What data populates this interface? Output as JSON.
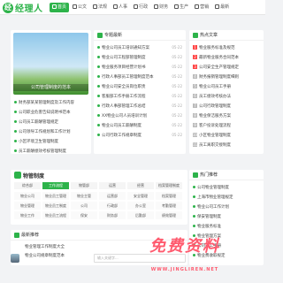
{
  "brand": {
    "logo_letter": "经",
    "name": "经理人"
  },
  "nav": [
    {
      "label": "首页",
      "icon": "home-icon",
      "active": true
    },
    {
      "label": "公文",
      "icon": "doc-icon"
    },
    {
      "label": "法规",
      "icon": "law-icon"
    },
    {
      "label": "人事",
      "icon": "person-icon"
    },
    {
      "label": "行政",
      "icon": "admin-icon"
    },
    {
      "label": "财务",
      "icon": "money-icon"
    },
    {
      "label": "生产",
      "icon": "factory-icon"
    },
    {
      "label": "营销",
      "icon": "market-icon"
    },
    {
      "label": "最新",
      "icon": "new-icon"
    }
  ],
  "hero": {
    "caption": "公司管理制度的范本"
  },
  "left_list": [
    "财务部某某管理制度及工作内容",
    "公司职业危害告知说明书范本",
    "公司员工薪酬管理规定",
    "公司领导工作规划和工作计划",
    "小区环境卫生管理制度",
    "员工薪酬绩效考核管理制度"
  ],
  "mid": {
    "title": "专题最新",
    "items": [
      {
        "t": "物业公司员工培训通知方案",
        "d": "05-22"
      },
      {
        "t": "物业公司工程部管理制度",
        "d": "05-22"
      },
      {
        "t": "物业服务项目经营计划书",
        "d": "05-22"
      },
      {
        "t": "行政人事部员工管理制度范本",
        "d": "05-22"
      },
      {
        "t": "物业公司安全员岗位职责",
        "d": "05-22"
      },
      {
        "t": "客服部工作手册工作流程",
        "d": "05-22"
      },
      {
        "t": "行政人事部管理工作总结",
        "d": "05-22"
      },
      {
        "t": "XX物业公司人员培训计划",
        "d": "05-22"
      },
      {
        "t": "物业公司员工薪酬制度",
        "d": "05-22"
      },
      {
        "t": "公司行政工作规章制度",
        "d": "05-22"
      }
    ]
  },
  "right": {
    "title": "热点文章",
    "items": [
      "物业服务标准及规范",
      "最新物业服务合同范本",
      "公司安全生产管理规定",
      "财务报销管理制度细则",
      "物业公司员工手册",
      "员工绩效考核办法",
      "公司行政管理制度",
      "物业保洁服务方案",
      "客户投诉处理流程",
      "小区物业管理制度",
      "员工离职交接制度"
    ]
  },
  "tree": {
    "title": "物管制度",
    "tabs": [
      "综合部",
      "工作流程",
      "物管部",
      "运营",
      "经营",
      "档案管理制度"
    ],
    "active_tab": 1,
    "cells": [
      "物业公司",
      "物业员工管理",
      "物业主管",
      "运营部",
      "安全管理",
      "档案管理",
      "物业管理",
      "物业员工制度",
      "公司",
      "行政部",
      "办公室",
      "考勤管理",
      "物业工作",
      "物业员工流程",
      "保安",
      "财务部",
      "后勤部",
      "绩效管理"
    ]
  },
  "hot": {
    "title": "热门推荐",
    "items": [
      "公司物业管理制度",
      "上海市物业管理规定",
      "物业公司工作计划",
      "保安管理制度",
      "物业服务标准",
      "物业管理方案",
      "公司员工手册",
      "物业费收取规定"
    ]
  },
  "news": {
    "title": "最新推荐",
    "items": [
      "物业管理工作制度大全",
      "物业公司规章制度范本"
    ]
  },
  "search": {
    "placeholder": "输入关键字..."
  },
  "watermark": {
    "text": "免费资料",
    "sub": "WWW.JINGLIREN.NET"
  }
}
